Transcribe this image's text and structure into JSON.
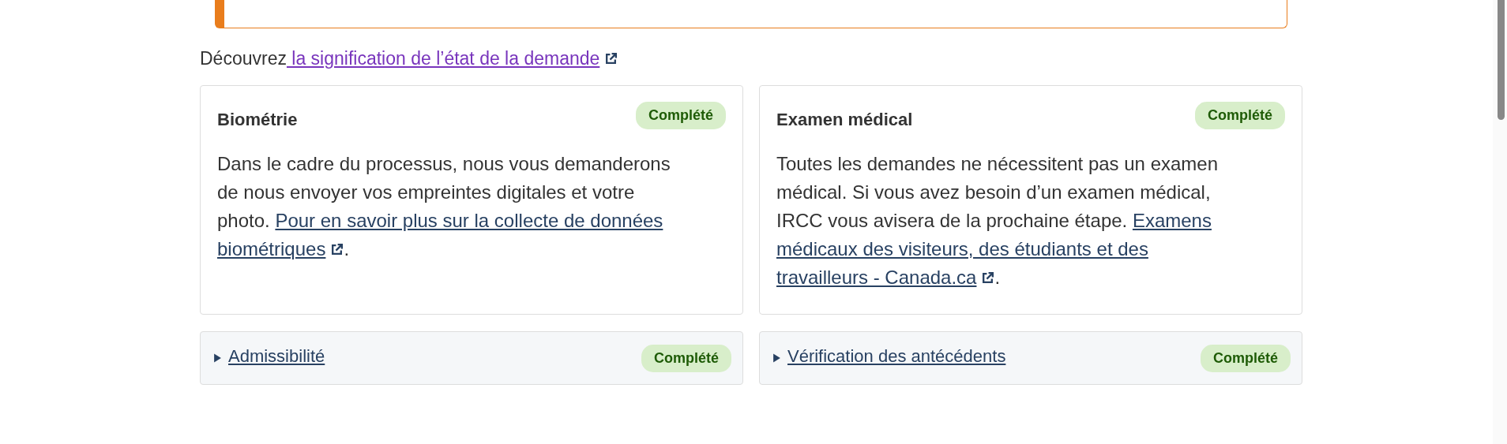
{
  "intro": {
    "text": "Découvrez",
    "link": " la signification de l’état de la demande"
  },
  "cards": [
    {
      "title": "Biométrie",
      "status": "Complété",
      "body": "Dans le cadre du processus, nous vous demanderons de nous envoyer vos empreintes digitales et votre photo. ",
      "link": "Pour en savoir plus sur la collecte de données biométriques",
      "after": "."
    },
    {
      "title": "Examen médical",
      "status": "Complété",
      "body": "Toutes les demandes ne nécessitent pas un examen médical. Si vous avez besoin d’un examen médical, IRCC vous avisera de la prochaine étape. ",
      "link": "Examens médicaux des visiteurs, des étudiants et des travailleurs - Canada.ca",
      "after": "."
    }
  ],
  "sections": [
    {
      "title": "Admissibilité",
      "status": "Complété",
      "expanded": false
    },
    {
      "title": "Vérification des antécédents",
      "status": "Complété",
      "expanded": false
    }
  ]
}
